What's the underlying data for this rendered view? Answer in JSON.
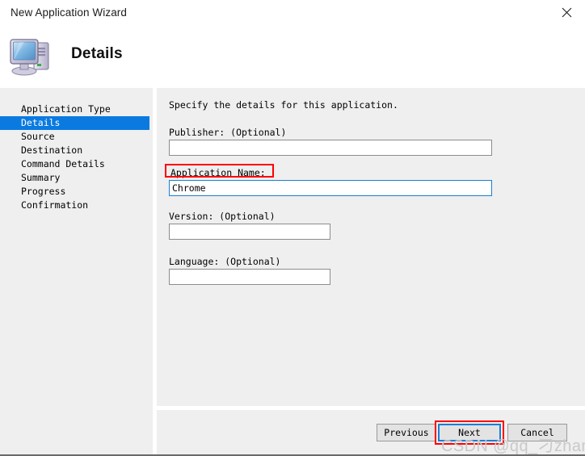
{
  "window": {
    "title": "New Application Wizard",
    "close_icon": "close-icon"
  },
  "header": {
    "icon": "computer-icon",
    "page_title": "Details"
  },
  "sidebar": {
    "items": [
      {
        "label": "Application Type",
        "selected": false
      },
      {
        "label": "Details",
        "selected": true
      },
      {
        "label": "Source",
        "selected": false
      },
      {
        "label": "Destination",
        "selected": false
      },
      {
        "label": "Command Details",
        "selected": false
      },
      {
        "label": "Summary",
        "selected": false
      },
      {
        "label": "Progress",
        "selected": false
      },
      {
        "label": "Confirmation",
        "selected": false
      }
    ]
  },
  "content": {
    "instruction": "Specify the details for this application.",
    "fields": {
      "publisher": {
        "label": "Publisher: (Optional)",
        "value": "",
        "placeholder": ""
      },
      "application_name": {
        "label": "Application Name:",
        "value": "Chrome",
        "placeholder": ""
      },
      "version": {
        "label": "Version: (Optional)",
        "value": "",
        "placeholder": ""
      },
      "language": {
        "label": "Language: (Optional)",
        "value": "",
        "placeholder": ""
      }
    }
  },
  "buttons": {
    "previous": "Previous",
    "next": "Next",
    "cancel": "Cancel"
  },
  "annotations": {
    "highlight_color": "#fe0000",
    "focus_color": "#1a7fd4",
    "selection_color": "#0a7ae0"
  },
  "watermark": {
    "text": "CSDN @qq_刁zhang"
  }
}
